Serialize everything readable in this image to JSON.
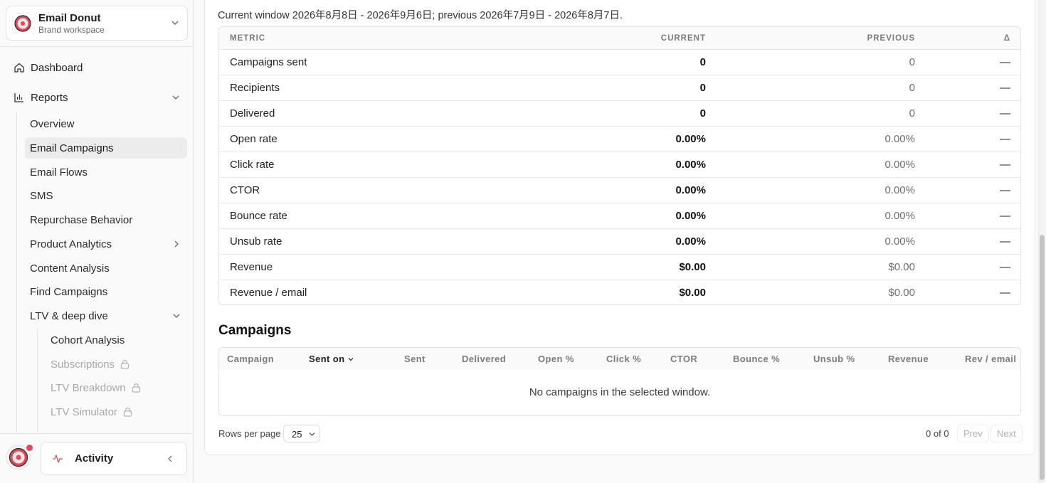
{
  "workspace": {
    "name": "Email Donut",
    "subtitle": "Brand workspace",
    "icon": "donut-logo-icon"
  },
  "nav": {
    "dashboard": "Dashboard",
    "reports": "Reports",
    "report_items": [
      "Overview",
      "Email Campaigns",
      "Email Flows",
      "SMS",
      "Repurchase Behavior",
      "Product Analytics",
      "Content Analysis",
      "Find Campaigns",
      "LTV & deep dive"
    ],
    "active_item": "Email Campaigns",
    "ltv_items": [
      {
        "label": "Cohort Analysis",
        "locked": false
      },
      {
        "label": "Subscriptions",
        "locked": true
      },
      {
        "label": "LTV Breakdown",
        "locked": true
      },
      {
        "label": "LTV Simulator",
        "locked": true
      }
    ]
  },
  "activity": {
    "label": "Activity"
  },
  "comparison": {
    "window_text": "Current window 2026年8月8日 - 2026年9月6日; previous 2026年7月9日 - 2026年8月7日.",
    "headers": {
      "metric": "METRIC",
      "current": "CURRENT",
      "previous": "PREVIOUS",
      "delta": "Δ"
    },
    "rows": [
      {
        "metric": "Campaigns sent",
        "current": "0",
        "previous": "0",
        "delta": "—"
      },
      {
        "metric": "Recipients",
        "current": "0",
        "previous": "0",
        "delta": "—"
      },
      {
        "metric": "Delivered",
        "current": "0",
        "previous": "0",
        "delta": "—"
      },
      {
        "metric": "Open rate",
        "current": "0.00%",
        "previous": "0.00%",
        "delta": "—"
      },
      {
        "metric": "Click rate",
        "current": "0.00%",
        "previous": "0.00%",
        "delta": "—"
      },
      {
        "metric": "CTOR",
        "current": "0.00%",
        "previous": "0.00%",
        "delta": "—"
      },
      {
        "metric": "Bounce rate",
        "current": "0.00%",
        "previous": "0.00%",
        "delta": "—"
      },
      {
        "metric": "Unsub rate",
        "current": "0.00%",
        "previous": "0.00%",
        "delta": "—"
      },
      {
        "metric": "Revenue",
        "current": "$0.00",
        "previous": "$0.00",
        "delta": "—"
      },
      {
        "metric": "Revenue / email",
        "current": "$0.00",
        "previous": "$0.00",
        "delta": "—"
      }
    ]
  },
  "campaigns": {
    "title": "Campaigns",
    "columns": [
      "Campaign",
      "Sent on",
      "Sent",
      "Delivered",
      "Open %",
      "Click %",
      "CTOR",
      "Bounce %",
      "Unsub %",
      "Revenue",
      "Rev / email"
    ],
    "sorted_column": "Sent on",
    "empty_text": "No campaigns in the selected window.",
    "pagination": {
      "rows_per_page_label": "Rows per page",
      "rows_per_page": "25",
      "count": "0 of 0",
      "prev": "Prev",
      "next": "Next"
    }
  },
  "colors": {
    "brand": "#e0485a",
    "active_bg": "#ececec",
    "muted": "#a8a8a8"
  }
}
